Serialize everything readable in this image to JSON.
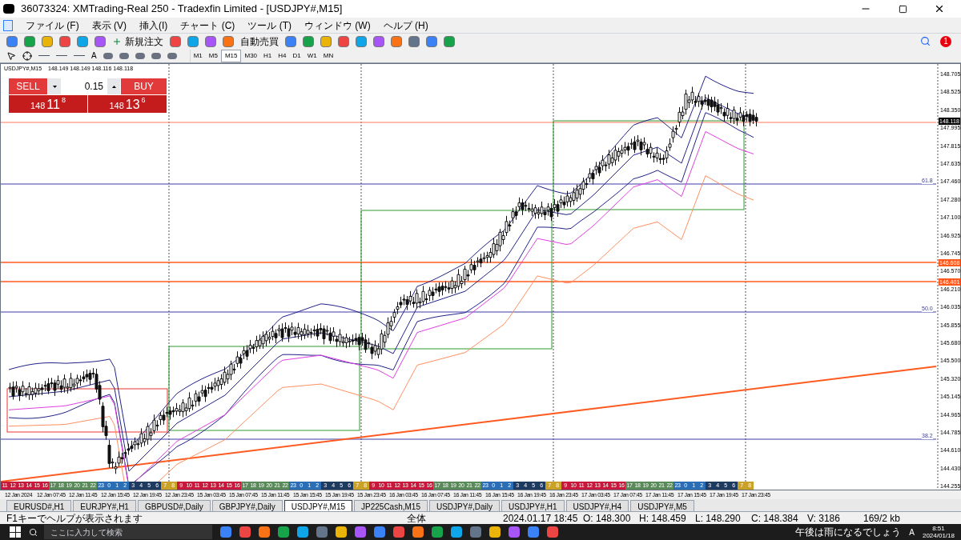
{
  "window": {
    "title": "36073324: XMTrading-Real 250 - Tradexfin Limited - [USDJPY#,M15]"
  },
  "menu": [
    "ファイル (F)",
    "表示 (V)",
    "挿入(I)",
    "チャート (C)",
    "ツール (T)",
    "ウィンドウ (W)",
    "ヘルプ (H)"
  ],
  "toolbar": {
    "new_order": "新規注文",
    "auto_trading": "自動売買",
    "text_tool": "A",
    "timeframes": [
      {
        "label": "M1",
        "selected": false
      },
      {
        "label": "M5",
        "selected": false
      },
      {
        "label": "M15",
        "selected": true
      },
      {
        "label": "M30",
        "selected": false
      },
      {
        "label": "H1",
        "selected": false
      },
      {
        "label": "H4",
        "selected": false
      },
      {
        "label": "D1",
        "selected": false
      },
      {
        "label": "W1",
        "selected": false
      },
      {
        "label": "MN",
        "selected": false
      }
    ],
    "notification_count": "1"
  },
  "chart": {
    "header": {
      "symbol": "USDJPY#,M15",
      "ohlc": "148.149 148.149 148.116 148.118"
    },
    "one_click": {
      "sell": "SELL",
      "buy": "BUY",
      "lot": "0.15",
      "sell_price": [
        "148",
        "11",
        "8"
      ],
      "buy_price": [
        "148",
        "13",
        "6"
      ]
    },
    "price_ticks": [
      "148.705",
      "148.525",
      "148.350",
      "147.995",
      "147.815",
      "147.635",
      "147.460",
      "147.280",
      "147.100",
      "146.925",
      "146.745",
      "146.570",
      "146.210",
      "146.035",
      "145.855",
      "145.680",
      "145.500",
      "145.320",
      "145.145",
      "144.965",
      "144.785",
      "144.610",
      "144.430",
      "144.255"
    ],
    "price_markers": [
      {
        "label": "148.118",
        "color": "#000000"
      },
      {
        "label": "146.608",
        "color": "#ff5a1f"
      },
      {
        "label": "146.401",
        "color": "#ff5a1f"
      }
    ],
    "fibo_labels": [
      "61.8",
      "50.0",
      "38.2"
    ],
    "session_strip": [
      {
        "color": "#c8193c",
        "hours": [
          "11",
          "12",
          "13",
          "14",
          "15",
          "16"
        ]
      },
      {
        "color": "#5a8a5a",
        "hours": [
          "17",
          "18",
          "19",
          "20",
          "21",
          "22"
        ]
      },
      {
        "color": "#2a6fb5",
        "hours": [
          "23",
          "0",
          "1",
          "2"
        ]
      },
      {
        "color": "#1f3a5f",
        "hours": [
          "3",
          "4",
          "5",
          "6"
        ]
      },
      {
        "color": "#c9a227",
        "hours": [
          "7",
          "8"
        ]
      },
      {
        "color": "#c8193c",
        "hours": [
          "9",
          "10",
          "11",
          "12",
          "13",
          "14",
          "15",
          "16"
        ]
      },
      {
        "color": "#5a8a5a",
        "hours": [
          "17",
          "18",
          "19",
          "20",
          "21",
          "22"
        ]
      },
      {
        "color": "#2a6fb5",
        "hours": [
          "23",
          "0",
          "1",
          "2"
        ]
      },
      {
        "color": "#1f3a5f",
        "hours": [
          "3",
          "4",
          "5",
          "6"
        ]
      },
      {
        "color": "#c9a227",
        "hours": [
          "7",
          "8"
        ]
      },
      {
        "color": "#c8193c",
        "hours": [
          "9",
          "10",
          "11",
          "12",
          "13",
          "14",
          "15",
          "16"
        ]
      },
      {
        "color": "#5a8a5a",
        "hours": [
          "17",
          "18",
          "19",
          "20",
          "21",
          "22"
        ]
      },
      {
        "color": "#2a6fb5",
        "hours": [
          "23",
          "0",
          "1",
          "2"
        ]
      },
      {
        "color": "#1f3a5f",
        "hours": [
          "3",
          "4",
          "5",
          "6"
        ]
      },
      {
        "color": "#c9a227",
        "hours": [
          "7",
          "8"
        ]
      },
      {
        "color": "#c8193c",
        "hours": [
          "9",
          "10",
          "11",
          "12",
          "13",
          "14",
          "15",
          "16"
        ]
      },
      {
        "color": "#5a8a5a",
        "hours": [
          "17",
          "18",
          "19",
          "20",
          "21",
          "22"
        ]
      },
      {
        "color": "#2a6fb5",
        "hours": [
          "23",
          "0",
          "1",
          "2"
        ]
      },
      {
        "color": "#1f3a5f",
        "hours": [
          "3",
          "4",
          "5",
          "6"
        ]
      },
      {
        "color": "#c9a227",
        "hours": [
          "7",
          "8"
        ]
      }
    ],
    "time_labels": [
      "12 Jan 2024",
      "12 Jan 07:45",
      "12 Jan 11:45",
      "12 Jan 15:45",
      "12 Jan 19:45",
      "12 Jan 23:45",
      "15 Jan 03:45",
      "15 Jan 07:45",
      "15 Jan 11:45",
      "15 Jan 15:45",
      "15 Jan 19:45",
      "15 Jan 23:45",
      "16 Jan 03:45",
      "16 Jan 07:45",
      "16 Jan 11:45",
      "16 Jan 15:45",
      "16 Jan 19:45",
      "16 Jan 23:45",
      "17 Jan 03:45",
      "17 Jan 07:45",
      "17 Jan 11:45",
      "17 Jan 15:45",
      "17 Jan 19:45",
      "17 Jan 23:45"
    ]
  },
  "chart_tabs": [
    {
      "label": "EURUSD#,H1",
      "selected": false
    },
    {
      "label": "EURJPY#,H1",
      "selected": false
    },
    {
      "label": "GBPUSD#,Daily",
      "selected": false
    },
    {
      "label": "GBPJPY#,Daily",
      "selected": false
    },
    {
      "label": "USDJPY#,M15",
      "selected": true
    },
    {
      "label": "JP225Cash,M15",
      "selected": false
    },
    {
      "label": "USDJPY#,Daily",
      "selected": false
    },
    {
      "label": "USDJPY#,H1",
      "selected": false
    },
    {
      "label": "USDJPY#,H4",
      "selected": false
    },
    {
      "label": "USDJPY#,M5",
      "selected": false
    }
  ],
  "status_bar": {
    "help": "F1キーでヘルプが表示されます",
    "profile": "全体",
    "time": "2024.01.17 18:45",
    "open": "O: 148.300",
    "high": "H: 148.459",
    "low": "L: 148.290",
    "close": "C: 148.384",
    "volume": "V: 3186",
    "traffic": "169/2 kb"
  },
  "taskbar": {
    "search_placeholder": "ここに入力して検索",
    "weather": "午後は雨になるでしょう",
    "ime": "A",
    "clock_time": "8:51",
    "clock_date": "2024/01/18"
  }
}
